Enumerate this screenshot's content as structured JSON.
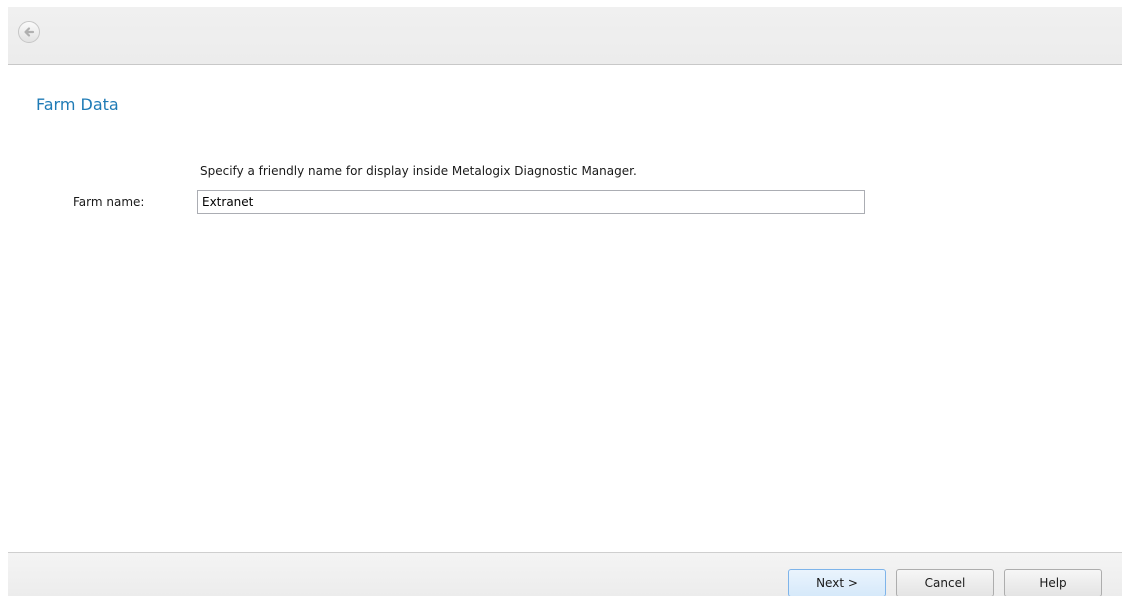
{
  "topbar": {
    "back_icon": "back-arrow-icon"
  },
  "page": {
    "title": "Farm Data",
    "instruction": "Specify a friendly name for display inside Metalogix Diagnostic Manager."
  },
  "form": {
    "farm_name_label": "Farm name:",
    "farm_name_value": "Extranet"
  },
  "buttons": {
    "next_label": "Next >",
    "cancel_label": "Cancel",
    "help_label": "Help"
  }
}
